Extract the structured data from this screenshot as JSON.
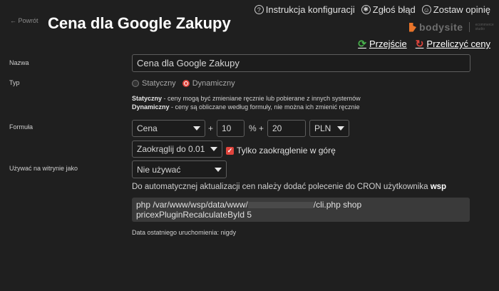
{
  "header": {
    "back_label": "← Powrót",
    "title": "Cena dla Google Zakupy"
  },
  "top_links": [
    {
      "label": "Instrukcja konfiguracji",
      "icon": "question-icon"
    },
    {
      "label": "Zgłoś błąd",
      "icon": "bug-icon"
    },
    {
      "label": "Zostaw opinię",
      "icon": "smile-icon"
    }
  ],
  "brand": {
    "name": "bodysite",
    "tagline": "ecommerce studio"
  },
  "actions": {
    "go_label": "Przejście",
    "recalc_label": "Przeliczyć ceny"
  },
  "form": {
    "name_label": "Nazwa",
    "name_value": "Cena dla Google Zakupy",
    "type_label": "Typ",
    "type_static": "Statyczny",
    "type_dynamic": "Dynamiczny",
    "type_selected": "Dynamiczny",
    "static_term": "Statyczny",
    "static_desc": " - ceny mogą być zmieniane ręcznie lub pobierane z innych systemów",
    "dynamic_term": "Dynamiczny",
    "dynamic_desc": " - ceny są obliczane według formuły, nie można ich zmienić ręcznie",
    "formula_label": "Formuła",
    "formula_base": "Cena",
    "formula_plus1": "+",
    "formula_percent_value": "10",
    "formula_percent_sign": "%",
    "formula_plus2": "+",
    "formula_amount_value": "20",
    "formula_currency": "PLN",
    "rounding_value": "Zaokrąglij do 0.01",
    "round_up_label": "Tylko zaokrąglenie w górę",
    "round_up_checked": true,
    "use_label": "Używać na witrynie jako",
    "use_value": "Nie używać",
    "cron_text": "Do automatycznej aktualizacji cen należy dodać polecenie do CRON użytkownika ",
    "cron_user": "wsp",
    "cron_cmd_part1": "php /var/www/wsp/data/www/",
    "cron_cmd_part2": "/cli.php shop",
    "cron_cmd_line2": "pricexPluginRecalculateById 5",
    "last_run": "Data ostatniego uruchomienia: nigdy"
  },
  "colors": {
    "background": "#1f1f1f",
    "accent_red": "#e0443c",
    "accent_green": "#47b04b",
    "brand_orange": "#e8742a"
  }
}
